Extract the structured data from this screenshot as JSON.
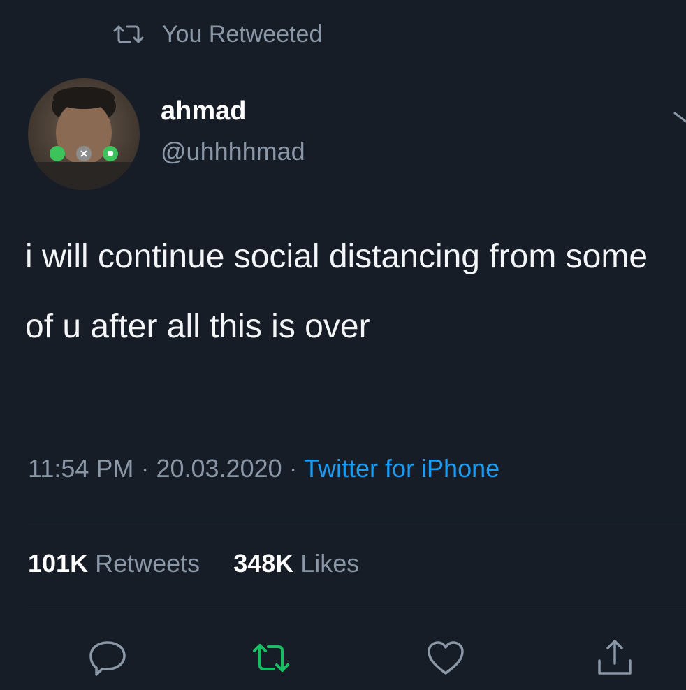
{
  "retweet_context": {
    "label": "You Retweeted",
    "icon": "retweet-icon"
  },
  "author": {
    "name": "ahmad",
    "handle": "@uhhhhmad",
    "avatar_icon": "avatar-photo"
  },
  "tweet": {
    "text": "i will continue social distancing from some of u after all this is over"
  },
  "meta": {
    "time": "11:54 PM",
    "separator": "·",
    "date": "20.03.2020",
    "source": "Twitter for iPhone"
  },
  "stats": {
    "retweets_count": "101K",
    "retweets_label": "Retweets",
    "likes_count": "348K",
    "likes_label": "Likes"
  },
  "actions": [
    {
      "name": "reply",
      "icon": "reply-icon"
    },
    {
      "name": "retweet",
      "icon": "retweet-icon",
      "active": true
    },
    {
      "name": "like",
      "icon": "heart-icon"
    },
    {
      "name": "share",
      "icon": "share-icon"
    }
  ],
  "colors": {
    "background": "#161d27",
    "muted_text": "#8a97a6",
    "link": "#1d9bf0",
    "retweet_active": "#17bf63",
    "divider": "#2f3a47"
  }
}
